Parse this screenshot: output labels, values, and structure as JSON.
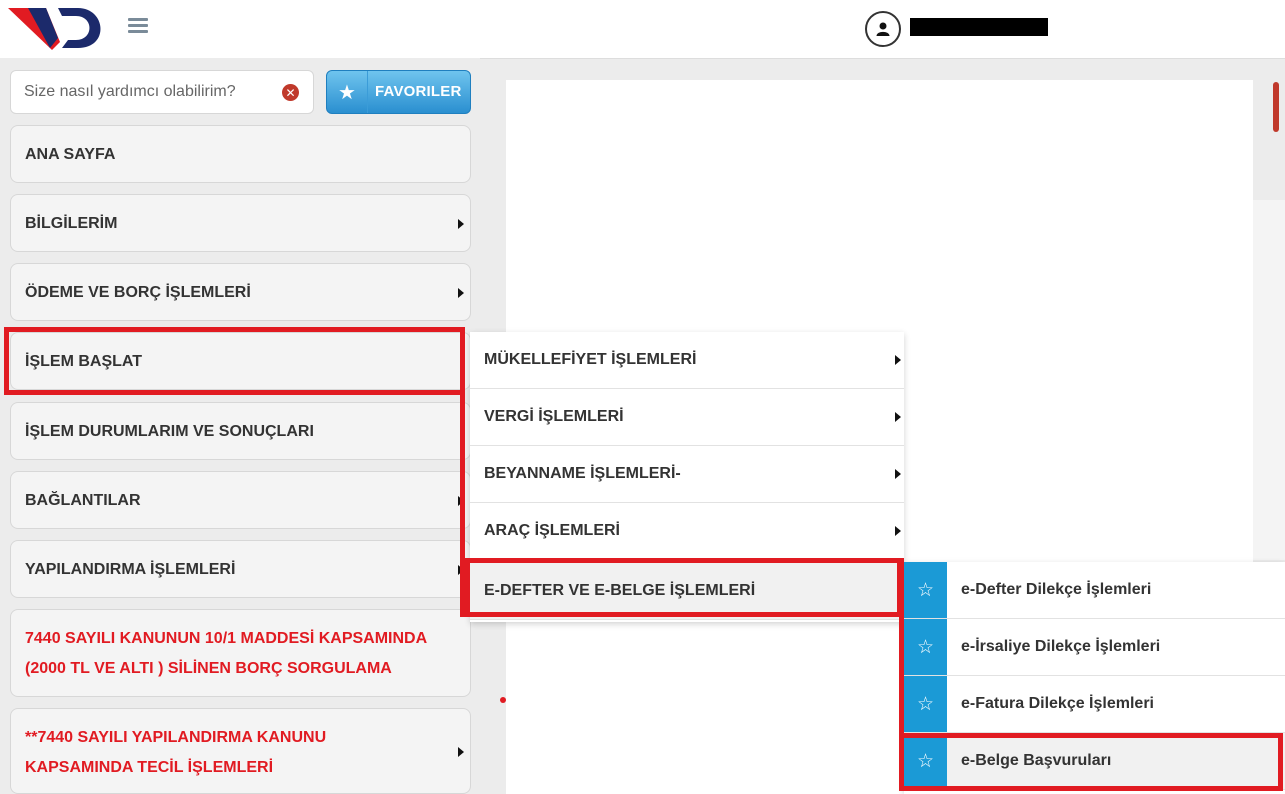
{
  "header": {
    "logo_text": "VD",
    "user_icon": "user-icon",
    "menu_icon": "hamburger-icon"
  },
  "search": {
    "placeholder": "Size nasıl yardımcı olabilirim?",
    "clear_icon": "times-circle-icon"
  },
  "favorites": {
    "label": "FAVORILER",
    "icon": "star-icon"
  },
  "sidebar": {
    "items": [
      {
        "label": "ANA SAYFA"
      },
      {
        "label": "BİLGİLERİM"
      },
      {
        "label": "ÖDEME VE BORÇ İŞLEMLERİ"
      },
      {
        "label": "İŞLEM BAŞLAT"
      },
      {
        "label": "İŞLEM DURUMLARIM VE SONUÇLARI"
      },
      {
        "label": "BAĞLANTILAR"
      },
      {
        "label": "YAPILANDIRMA İŞLEMLERİ"
      },
      {
        "label_line1": "7440 SAYILI KANUNUN 10/1 MADDESİ KAPSAMINDA",
        "label_line2": "(2000 TL VE ALTI ) SİLİNEN BORÇ SORGULAMA"
      },
      {
        "label_line1": "**7440 SAYILI YAPILANDIRMA KANUNU",
        "label_line2": "KAPSAMINDA TECİL İŞLEMLERİ"
      }
    ]
  },
  "submenu": {
    "items": [
      {
        "label": "MÜKELLEFİYET İŞLEMLERİ"
      },
      {
        "label": "VERGİ İŞLEMLERİ"
      },
      {
        "label": "BEYANNAME İŞLEMLERİ-"
      },
      {
        "label": "ARAÇ İŞLEMLERİ"
      },
      {
        "label": "E-DEFTER VE E-BELGE İŞLEMLERİ"
      }
    ]
  },
  "submenu2": {
    "items": [
      {
        "label": "e-Defter Dilekçe İşlemleri"
      },
      {
        "label": "e-İrsaliye Dilekçe İşlemleri"
      },
      {
        "label": "e-Fatura Dilekçe İşlemleri"
      },
      {
        "label": "e-Belge Başvuruları"
      }
    ]
  },
  "colors": {
    "accent_blue": "#1b9ad6",
    "highlight_red": "#e11b22",
    "logo_navy": "#1c2a6b"
  }
}
